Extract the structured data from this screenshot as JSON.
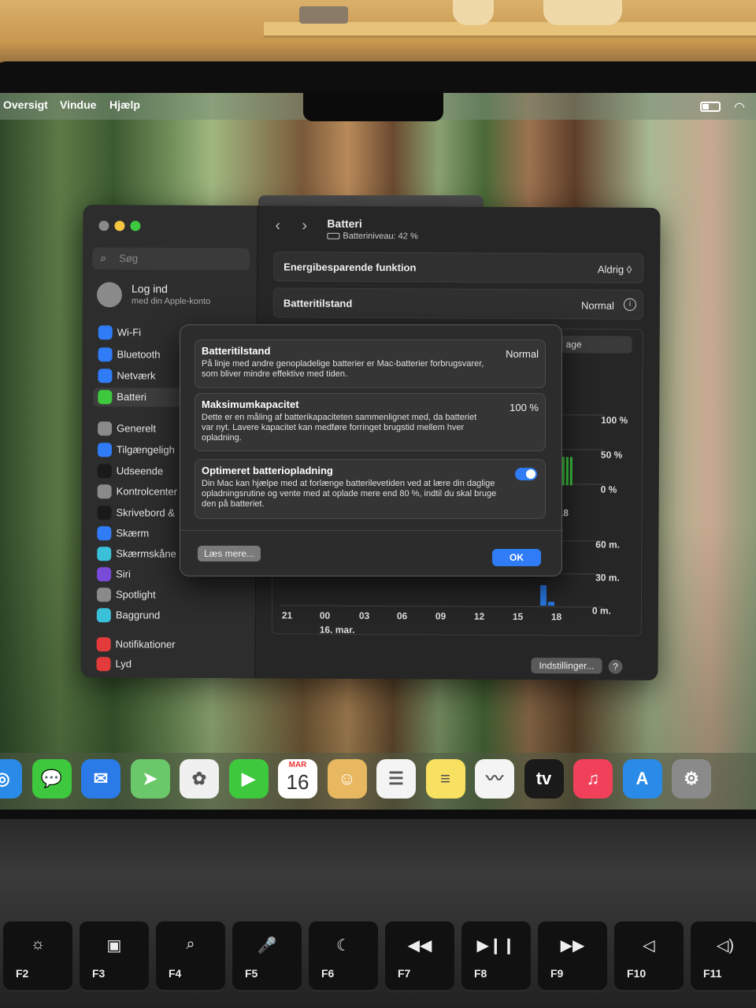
{
  "menubar": {
    "items": [
      "Oversigt",
      "Vindue",
      "Hjælp"
    ]
  },
  "window": {
    "search": {
      "placeholder": "Søg"
    },
    "account": {
      "name": "Log ind",
      "sub": "med din Apple-konto"
    },
    "sidebar": {
      "items": [
        {
          "label": "Wi-Fi",
          "color": "#2f7cf6",
          "icon": "wifi-icon"
        },
        {
          "label": "Bluetooth",
          "color": "#2f7cf6",
          "icon": "bluetooth-icon"
        },
        {
          "label": "Netværk",
          "color": "#2f7cf6",
          "icon": "globe-icon"
        },
        {
          "label": "Batteri",
          "color": "#3ec83e",
          "icon": "battery-icon",
          "active": true
        },
        {
          "label": "Generelt",
          "color": "#8a8a8a",
          "icon": "gear-icon"
        },
        {
          "label": "Tilgængeligh",
          "color": "#2f7cf6",
          "icon": "accessibility-icon"
        },
        {
          "label": "Udseende",
          "color": "#1a1a1a",
          "icon": "appearance-icon"
        },
        {
          "label": "Kontrolcenter",
          "color": "#8a8a8a",
          "icon": "control-center-icon"
        },
        {
          "label": "Skrivebord &",
          "color": "#1a1a1a",
          "icon": "desktop-icon"
        },
        {
          "label": "Skærm",
          "color": "#2f7cf6",
          "icon": "display-icon"
        },
        {
          "label": "Skærmskåne",
          "color": "#3ac0d8",
          "icon": "screensaver-icon"
        },
        {
          "label": "Siri",
          "color": "#7a4ad8",
          "icon": "siri-icon"
        },
        {
          "label": "Spotlight",
          "color": "#8a8a8a",
          "icon": "spotlight-icon"
        },
        {
          "label": "Baggrund",
          "color": "#3ac0d8",
          "icon": "wallpaper-icon"
        },
        {
          "label": "Notifikationer",
          "color": "#e33b3b",
          "icon": "notifications-icon"
        },
        {
          "label": "Lyd",
          "color": "#e33b3b",
          "icon": "sound-icon"
        }
      ]
    },
    "content": {
      "title": "Batteri",
      "subtitle": "Batteriniveau: 42 %",
      "rows": [
        {
          "label": "Energibesparende funktion",
          "value": "Aldrig ◊"
        },
        {
          "label": "Batteritilstand",
          "value": "Normal"
        }
      ],
      "tab_fragment": "age",
      "y_labels_top": [
        "100 %",
        "50 %",
        "0 %"
      ],
      "y_labels_bottom": [
        "60 m.",
        "30 m.",
        "0 m."
      ],
      "x_ticks": [
        "21",
        "00",
        "03",
        "06",
        "09",
        "12",
        "15",
        "18"
      ],
      "x_tick_mid": "18",
      "date_label": "16. mar.",
      "settings_button": "Indstillinger...",
      "help": "?"
    }
  },
  "modal": {
    "cards": [
      {
        "title": "Batteritilstand",
        "value": "Normal",
        "desc": "På linje med andre genopladelige batterier er Mac-batterier forbrugsvarer, som bliver mindre effektive med tiden."
      },
      {
        "title": "Maksimumkapacitet",
        "value": "100 %",
        "desc": "Dette er en måling af batterikapaciteten sammenlignet med, da batteriet var nyt. Lavere kapacitet kan medføre forringet brugstid mellem hver opladning."
      },
      {
        "title": "Optimeret batteriopladning",
        "toggle_on": true,
        "desc": "Din Mac kan hjælpe med at forlænge batterilevetiden ved at lære din daglige opladningsrutine og vente med at oplade mere end 80 %, indtil du skal bruge den på batteriet."
      }
    ],
    "learn_more": "Læs mere...",
    "ok": "OK"
  },
  "dock": {
    "apps": [
      {
        "name": "safari-icon",
        "color": "#2a8ae8",
        "glyph": "◎"
      },
      {
        "name": "messages-icon",
        "color": "#3ec83e",
        "glyph": "💬"
      },
      {
        "name": "mail-icon",
        "color": "#2a7ae8",
        "glyph": "✉"
      },
      {
        "name": "maps-icon",
        "color": "#6ac86a",
        "glyph": "➤"
      },
      {
        "name": "photos-icon",
        "color": "#f0f0f0",
        "glyph": "✿"
      },
      {
        "name": "facetime-icon",
        "color": "#3ec83e",
        "glyph": "▶"
      },
      {
        "name": "calendar-icon",
        "color": "#ffffff",
        "glyph": ""
      },
      {
        "name": "contacts-icon",
        "color": "#e8b860",
        "glyph": "☺"
      },
      {
        "name": "reminders-icon",
        "color": "#f4f4f4",
        "glyph": "☰"
      },
      {
        "name": "notes-icon",
        "color": "#f8e060",
        "glyph": "≡"
      },
      {
        "name": "freeform-icon",
        "color": "#f4f4f4",
        "glyph": "〰"
      },
      {
        "name": "tv-icon",
        "color": "#1a1a1a",
        "glyph": "tv"
      },
      {
        "name": "music-icon",
        "color": "#f0405a",
        "glyph": "♫"
      },
      {
        "name": "app-store-icon",
        "color": "#2a8ae8",
        "glyph": "A"
      },
      {
        "name": "system-settings-icon",
        "color": "#8a8a8a",
        "glyph": "⚙"
      }
    ],
    "calendar": {
      "month": "MAR",
      "day": "16"
    }
  },
  "keyboard": {
    "keys": [
      {
        "label": "F2",
        "icon": "☼"
      },
      {
        "label": "F3",
        "icon": "▣"
      },
      {
        "label": "F4",
        "icon": "⌕"
      },
      {
        "label": "F5",
        "icon": "🎤"
      },
      {
        "label": "F6",
        "icon": "☾"
      },
      {
        "label": "F7",
        "icon": "◀◀"
      },
      {
        "label": "F8",
        "icon": "▶❙❙"
      },
      {
        "label": "F9",
        "icon": "▶▶"
      },
      {
        "label": "F10",
        "icon": "◁"
      },
      {
        "label": "F11",
        "icon": "◁)"
      }
    ]
  }
}
